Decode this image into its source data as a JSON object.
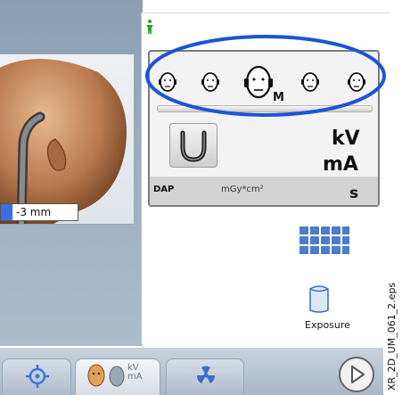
{
  "preview": {
    "offset_value": "-3 mm"
  },
  "patient_sizes": [
    {
      "icon": "head-size-icon"
    },
    {
      "icon": "head-size-icon"
    },
    {
      "icon": "head-size-icon",
      "label": "M",
      "selected": true
    },
    {
      "icon": "head-size-icon"
    },
    {
      "icon": "head-size-icon"
    }
  ],
  "settings": {
    "kv_label": "kV",
    "ma_label": "mA",
    "dap_label": "DAP",
    "dap_unit": "mGy*cm²",
    "s_label": "s"
  },
  "actions": {
    "exposure_label": "Exposure"
  },
  "bottom_nav": {
    "kv_ma_icon_text": "kV\nmA"
  },
  "figure_caption": "XR_2D_UM_061_2.eps",
  "colors": {
    "highlight_ellipse": "#1a56d6",
    "grid_icon": "#4f7cc9",
    "patient_icon": "#2aa02a",
    "radiation_icon": "#3b6ec9"
  }
}
